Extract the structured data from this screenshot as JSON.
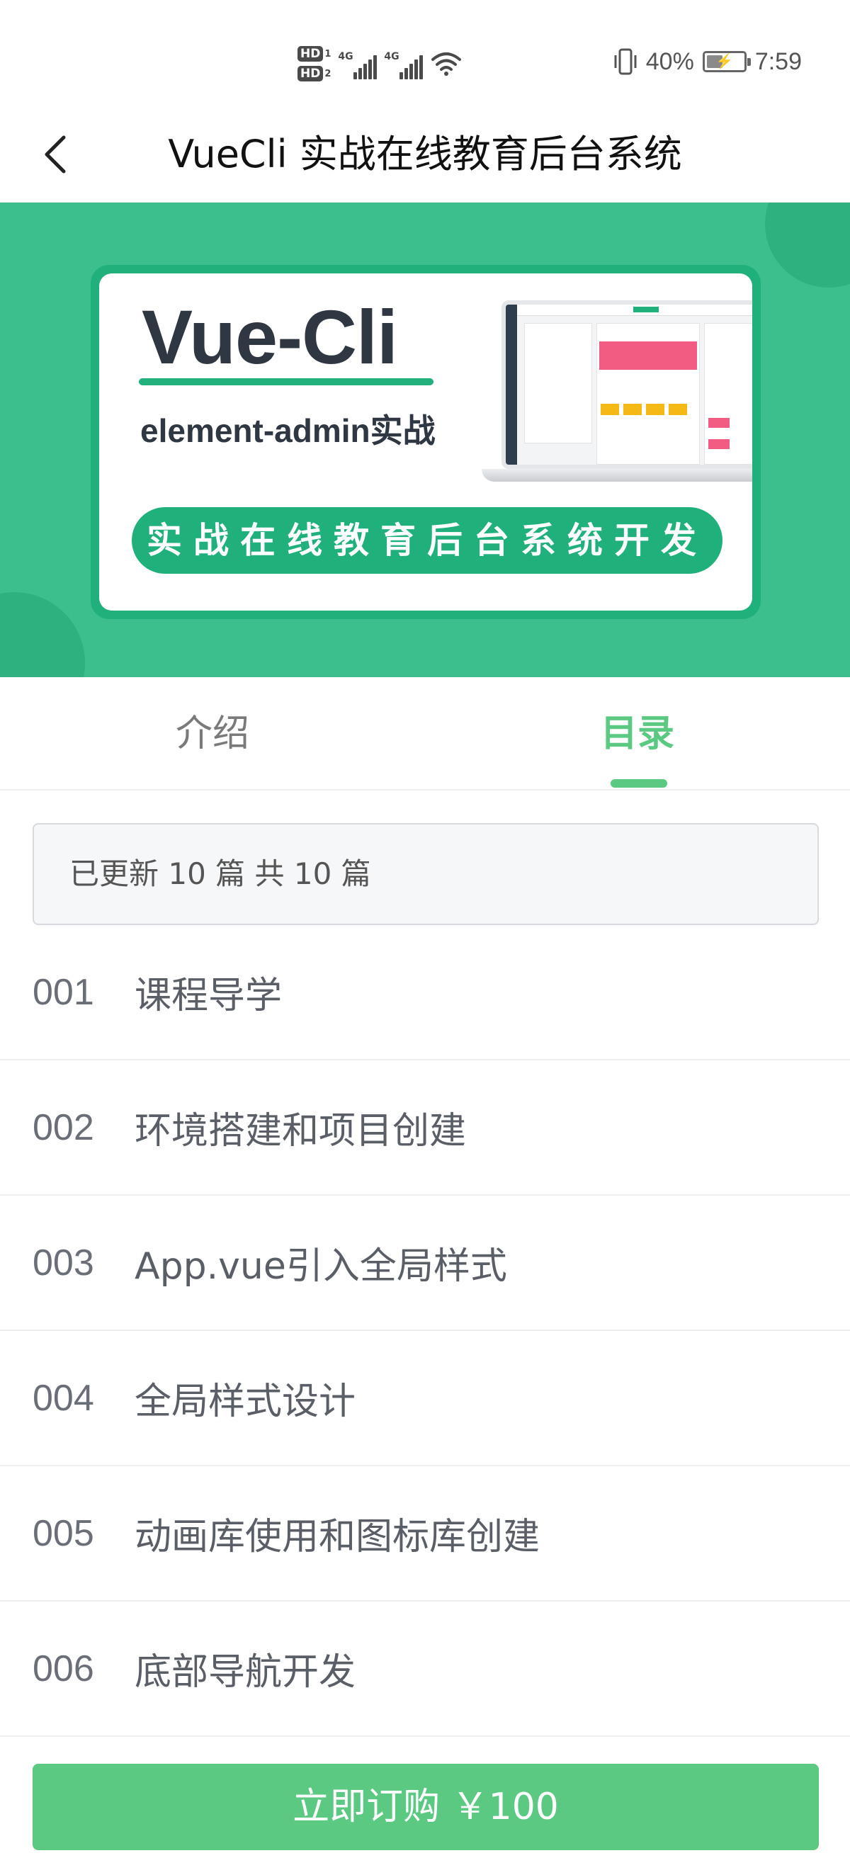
{
  "status_bar": {
    "hd1": "HD",
    "hd1_sub": "1",
    "hd2": "HD",
    "hd2_sub": "2",
    "net1": "4G",
    "net2": "4G",
    "battery_percent": "40%",
    "battery_level": 0.4,
    "time": "7:59"
  },
  "nav": {
    "title": "VueCli 实战在线教育后台系统"
  },
  "banner": {
    "title": "Vue-Cli",
    "subtitle": "element-admin实战",
    "pill_text": "实战在线教育后台系统开发"
  },
  "tabs": [
    {
      "label": "介绍",
      "active": false
    },
    {
      "label": "目录",
      "active": true
    }
  ],
  "update_info": "已更新 10 篇 共 10 篇",
  "chapters": [
    {
      "num": "001",
      "title": "课程导学"
    },
    {
      "num": "002",
      "title": "环境搭建和项目创建"
    },
    {
      "num": "003",
      "title": "App.vue引入全局样式"
    },
    {
      "num": "004",
      "title": "全局样式设计"
    },
    {
      "num": "005",
      "title": "动画库使用和图标库创建"
    },
    {
      "num": "006",
      "title": "底部导航开发"
    }
  ],
  "buy_button": "立即订购 ￥100",
  "colors": {
    "accent": "#5cc983",
    "banner_bg": "#3cbf8c",
    "banner_dark": "#1fb07b"
  }
}
